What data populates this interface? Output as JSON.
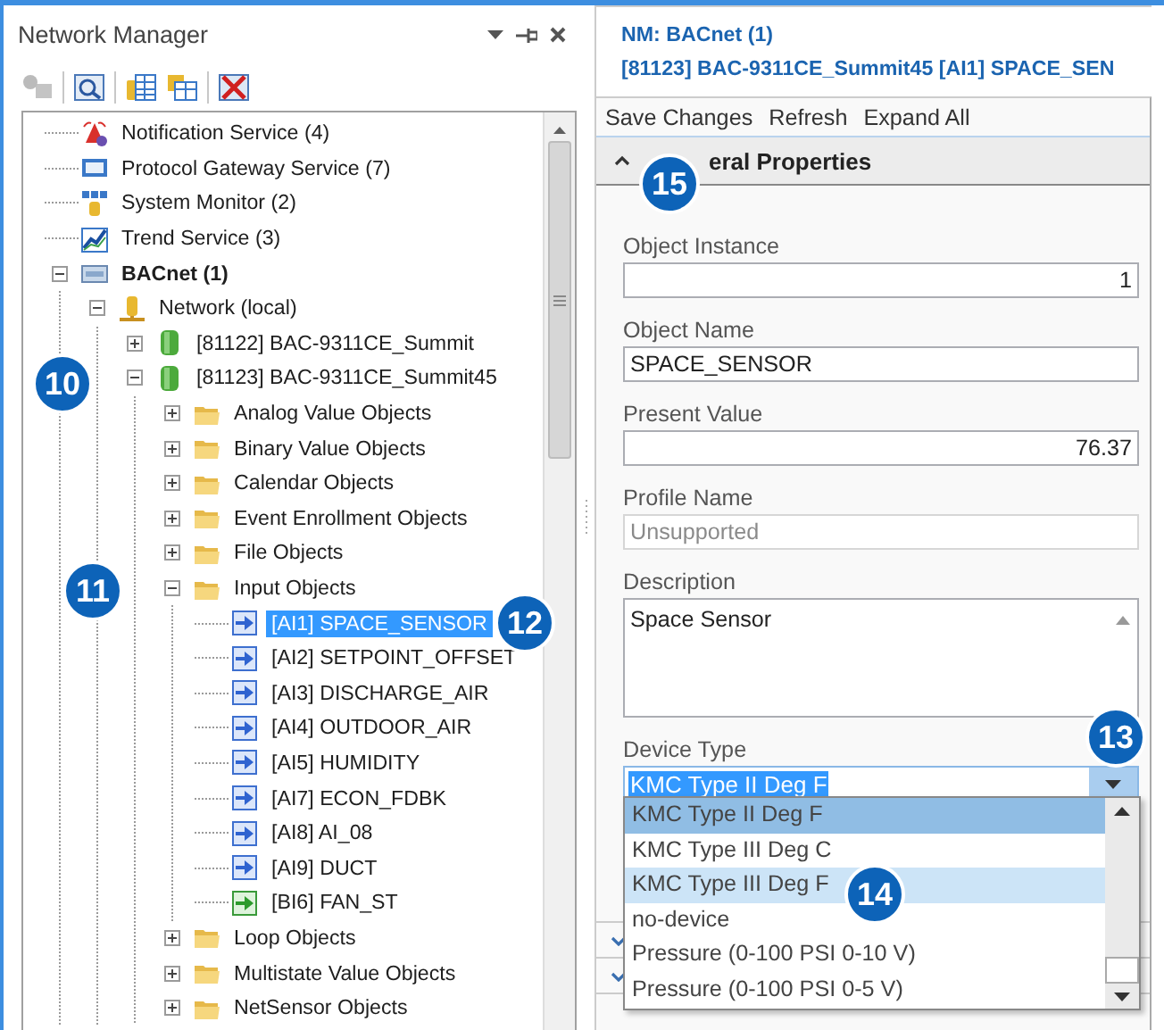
{
  "panel": {
    "title": "Network Manager"
  },
  "tree": [
    {
      "kind": "alarm",
      "label": "Notification Service (4)",
      "selected": false
    },
    {
      "kind": "gateway",
      "label": "Protocol Gateway Service (7)",
      "selected": false
    },
    {
      "kind": "monitor",
      "label": "System Monitor (2)",
      "selected": false
    },
    {
      "kind": "trend",
      "label": "Trend Service (3)",
      "selected": false
    },
    {
      "kind": "bacnet",
      "label": "BACnet (1)",
      "selected": false,
      "expanded": true,
      "children": [
        {
          "kind": "network",
          "label": "Network (local)",
          "selected": false,
          "expanded": true,
          "children": [
            {
              "kind": "device",
              "label": "[81122] BAC-9311CE_Summit",
              "selected": false,
              "expanded": false
            },
            {
              "kind": "device",
              "label": "[81123] BAC-9311CE_Summit45",
              "selected": false,
              "expanded": true,
              "children": [
                {
                  "kind": "folder",
                  "label": "Analog Value Objects",
                  "selected": false,
                  "expanded": false
                },
                {
                  "kind": "folder",
                  "label": "Binary Value Objects",
                  "selected": false,
                  "expanded": false
                },
                {
                  "kind": "folder",
                  "label": "Calendar Objects",
                  "selected": false,
                  "expanded": false
                },
                {
                  "kind": "folder",
                  "label": "Event Enrollment Objects",
                  "selected": false,
                  "expanded": false
                },
                {
                  "kind": "folder",
                  "label": "File Objects",
                  "selected": false,
                  "expanded": false
                },
                {
                  "kind": "folder",
                  "label": "Input Objects",
                  "selected": false,
                  "expanded": true,
                  "children": [
                    {
                      "kind": "analog-input",
                      "label": "[AI1] SPACE_SENSOR",
                      "selected": true
                    },
                    {
                      "kind": "analog-input",
                      "label": "[AI2] SETPOINT_OFFSET",
                      "selected": false
                    },
                    {
                      "kind": "analog-input",
                      "label": "[AI3] DISCHARGE_AIR",
                      "selected": false
                    },
                    {
                      "kind": "analog-input",
                      "label": "[AI4] OUTDOOR_AIR",
                      "selected": false
                    },
                    {
                      "kind": "analog-input",
                      "label": "[AI5] HUMIDITY",
                      "selected": false
                    },
                    {
                      "kind": "analog-input",
                      "label": "[AI7] ECON_FDBK",
                      "selected": false
                    },
                    {
                      "kind": "analog-input",
                      "label": "[AI8] AI_08",
                      "selected": false
                    },
                    {
                      "kind": "analog-input",
                      "label": "[AI9] DUCT",
                      "selected": false
                    },
                    {
                      "kind": "binary-input",
                      "label": "[BI6] FAN_ST",
                      "selected": false
                    }
                  ]
                },
                {
                  "kind": "folder",
                  "label": "Loop Objects",
                  "selected": false,
                  "expanded": false
                },
                {
                  "kind": "folder",
                  "label": "Multistate Value Objects",
                  "selected": false,
                  "expanded": false
                },
                {
                  "kind": "folder",
                  "label": "NetSensor Objects",
                  "selected": false,
                  "expanded": false
                }
              ]
            }
          ]
        }
      ]
    }
  ],
  "detail": {
    "header_line_1": "NM: BACnet (1)",
    "header_line_2": "[81123] BAC-9311CE_Summit45 [AI1] SPACE_SEN",
    "toolbar": [
      "Save Changes",
      "Refresh",
      "Expand All"
    ],
    "section": {
      "title": "eral Properties",
      "expanded": true
    },
    "fields": [
      {
        "kind": "number",
        "label": "Object Instance",
        "value": "1",
        "disabled": false
      },
      {
        "kind": "text",
        "label": "Object Name",
        "value": "SPACE_SENSOR",
        "disabled": false
      },
      {
        "kind": "number",
        "label": "Present Value",
        "value": "76.37",
        "disabled": false
      },
      {
        "kind": "text",
        "label": "Profile Name",
        "value": "Unsupported",
        "disabled": true
      },
      {
        "kind": "textarea",
        "label": "Description",
        "value": "Space Sensor",
        "disabled": false
      },
      {
        "kind": "combo",
        "label": "Device Type",
        "value": "KMC Type II Deg F",
        "disabled": false,
        "open": true,
        "options": [
          {
            "label": "KMC Type II Deg F",
            "selected": true,
            "hover": false
          },
          {
            "label": "KMC Type III Deg C",
            "selected": false,
            "hover": false
          },
          {
            "label": "KMC Type III Deg F",
            "selected": false,
            "hover": true
          },
          {
            "label": "no-device",
            "selected": false,
            "hover": false
          },
          {
            "label": "Pressure (0-100 PSI 0-10 V)",
            "selected": false,
            "hover": false
          },
          {
            "label": "Pressure (0-100 PSI 0-5 V)",
            "selected": false,
            "hover": false
          }
        ]
      }
    ],
    "collapsed_sections": [
      {
        "expanded": false
      },
      {
        "expanded": false
      }
    ]
  },
  "callouts": [
    "10",
    "11",
    "12",
    "13",
    "14",
    "15"
  ]
}
